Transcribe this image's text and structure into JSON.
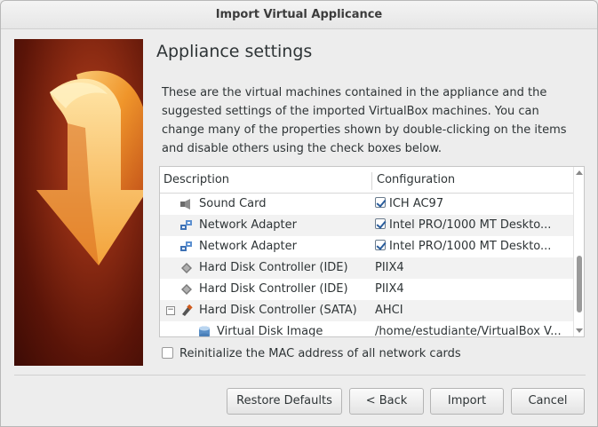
{
  "window": {
    "title": "Import Virtual Applicance"
  },
  "page": {
    "heading": "Appliance settings",
    "description": "These are the virtual machines contained in the appliance and the suggested settings of the imported VirtualBox machines. You can change many of the properties shown by double-clicking on the items and disable others using the check boxes below."
  },
  "tree": {
    "columns": [
      "Description",
      "Configuration"
    ],
    "rows": [
      {
        "icon": "sound-card-icon",
        "description": "Sound Card",
        "configuration": "ICH AC97",
        "checked": true
      },
      {
        "icon": "network-adapter-icon",
        "description": "Network Adapter",
        "configuration": "Intel PRO/1000 MT Deskto...",
        "checked": true
      },
      {
        "icon": "network-adapter-icon",
        "description": "Network Adapter",
        "configuration": "Intel PRO/1000 MT Deskto...",
        "checked": true
      },
      {
        "icon": "ide-controller-icon",
        "description": "Hard Disk Controller (IDE)",
        "configuration": "PIIX4"
      },
      {
        "icon": "ide-controller-icon",
        "description": "Hard Disk Controller (IDE)",
        "configuration": "PIIX4"
      },
      {
        "icon": "sata-controller-icon",
        "description": "Hard Disk Controller (SATA)",
        "configuration": "AHCI",
        "expanded": true
      },
      {
        "icon": "disk-image-icon",
        "description": "Virtual Disk Image",
        "configuration": "/home/estudiante/VirtualBox V...",
        "child": true
      }
    ]
  },
  "options": {
    "reinit_mac": "Reinitialize the MAC address of all network cards",
    "reinit_mac_checked": false
  },
  "buttons": {
    "restore": "Restore Defaults",
    "back": "< Back",
    "import": "Import",
    "cancel": "Cancel"
  },
  "colors": {
    "banner": "#8a2a12",
    "arrow": "#f0982a",
    "check": "#2a5d9c"
  }
}
